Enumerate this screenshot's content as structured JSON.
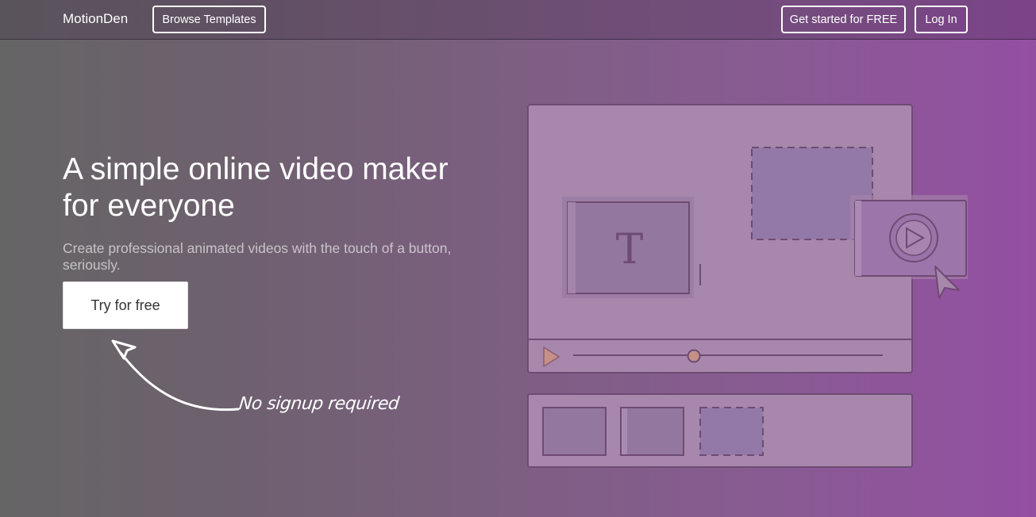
{
  "navbar": {
    "brand": "MotionDen",
    "browse_label": "Browse Templates",
    "get_started_label": "Get started for FREE",
    "login_label": "Log In"
  },
  "hero": {
    "headline_line1": "A simple online video maker",
    "headline_line2": "for everyone",
    "subtext": "Create professional animated videos with the touch of a button, seriously.",
    "cta_label": "Try for free",
    "note": "No signup required"
  },
  "illustration": {
    "text_glyph": "T",
    "timeline_progress": 0.39,
    "icons": [
      "text-icon",
      "play-icon",
      "cursor-icon",
      "timeline-play-icon"
    ]
  },
  "colors": {
    "gradient_start": "#656565",
    "gradient_end": "#944fa3",
    "panel": "#a887ad",
    "placeholder": "#9379a8",
    "outline": "#6e4b73"
  }
}
